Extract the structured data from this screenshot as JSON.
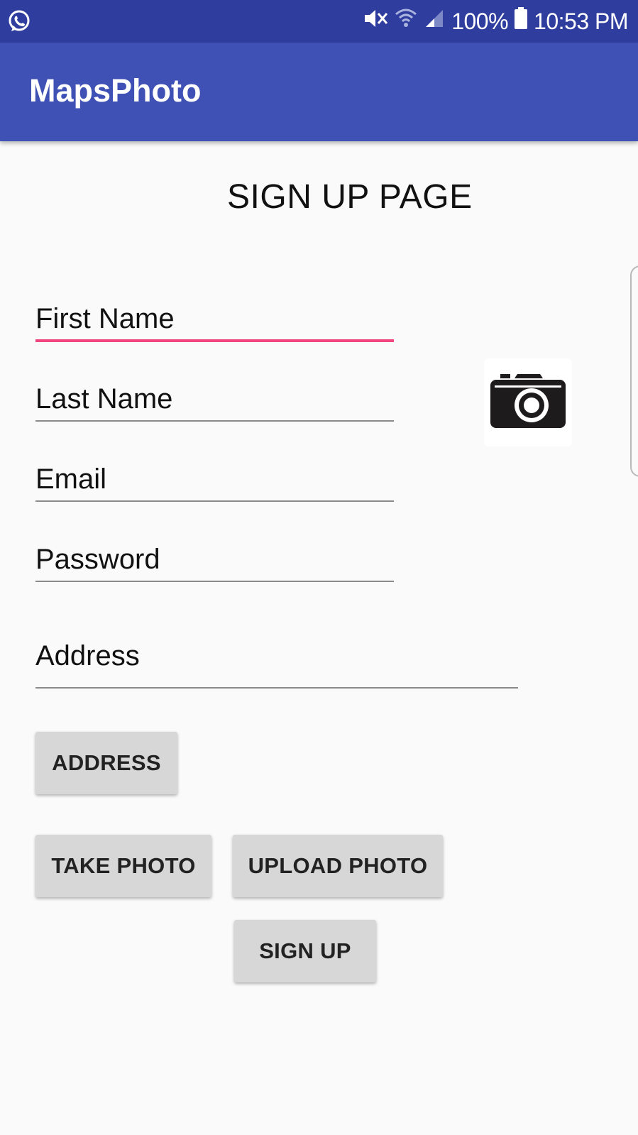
{
  "status_bar": {
    "left_icon": "whatsapp-icon",
    "icons": [
      "mute-icon",
      "wifi-icon",
      "signal-icon",
      "battery-icon"
    ],
    "battery_text": "100%",
    "time": "10:53 PM"
  },
  "app_bar": {
    "title": "MapsPhoto"
  },
  "page": {
    "title": "SIGN UP PAGE"
  },
  "form": {
    "first_name": {
      "placeholder": "First Name",
      "value": ""
    },
    "last_name": {
      "placeholder": "Last Name",
      "value": ""
    },
    "email": {
      "placeholder": "Email",
      "value": ""
    },
    "password": {
      "placeholder": "Password",
      "value": ""
    },
    "address": {
      "placeholder": "Address",
      "value": ""
    }
  },
  "buttons": {
    "address": "ADDRESS",
    "take_photo": "TAKE PHOTO",
    "upload_photo": "UPLOAD PHOTO",
    "sign_up": "SIGN UP"
  },
  "photo_preview": {
    "icon": "camera-icon"
  },
  "colors": {
    "status_bar": "#2f3e9e",
    "app_bar": "#3f51b5",
    "focus_accent": "#f0457d",
    "button_bg": "#d7d7d7",
    "background": "#fafafa"
  }
}
